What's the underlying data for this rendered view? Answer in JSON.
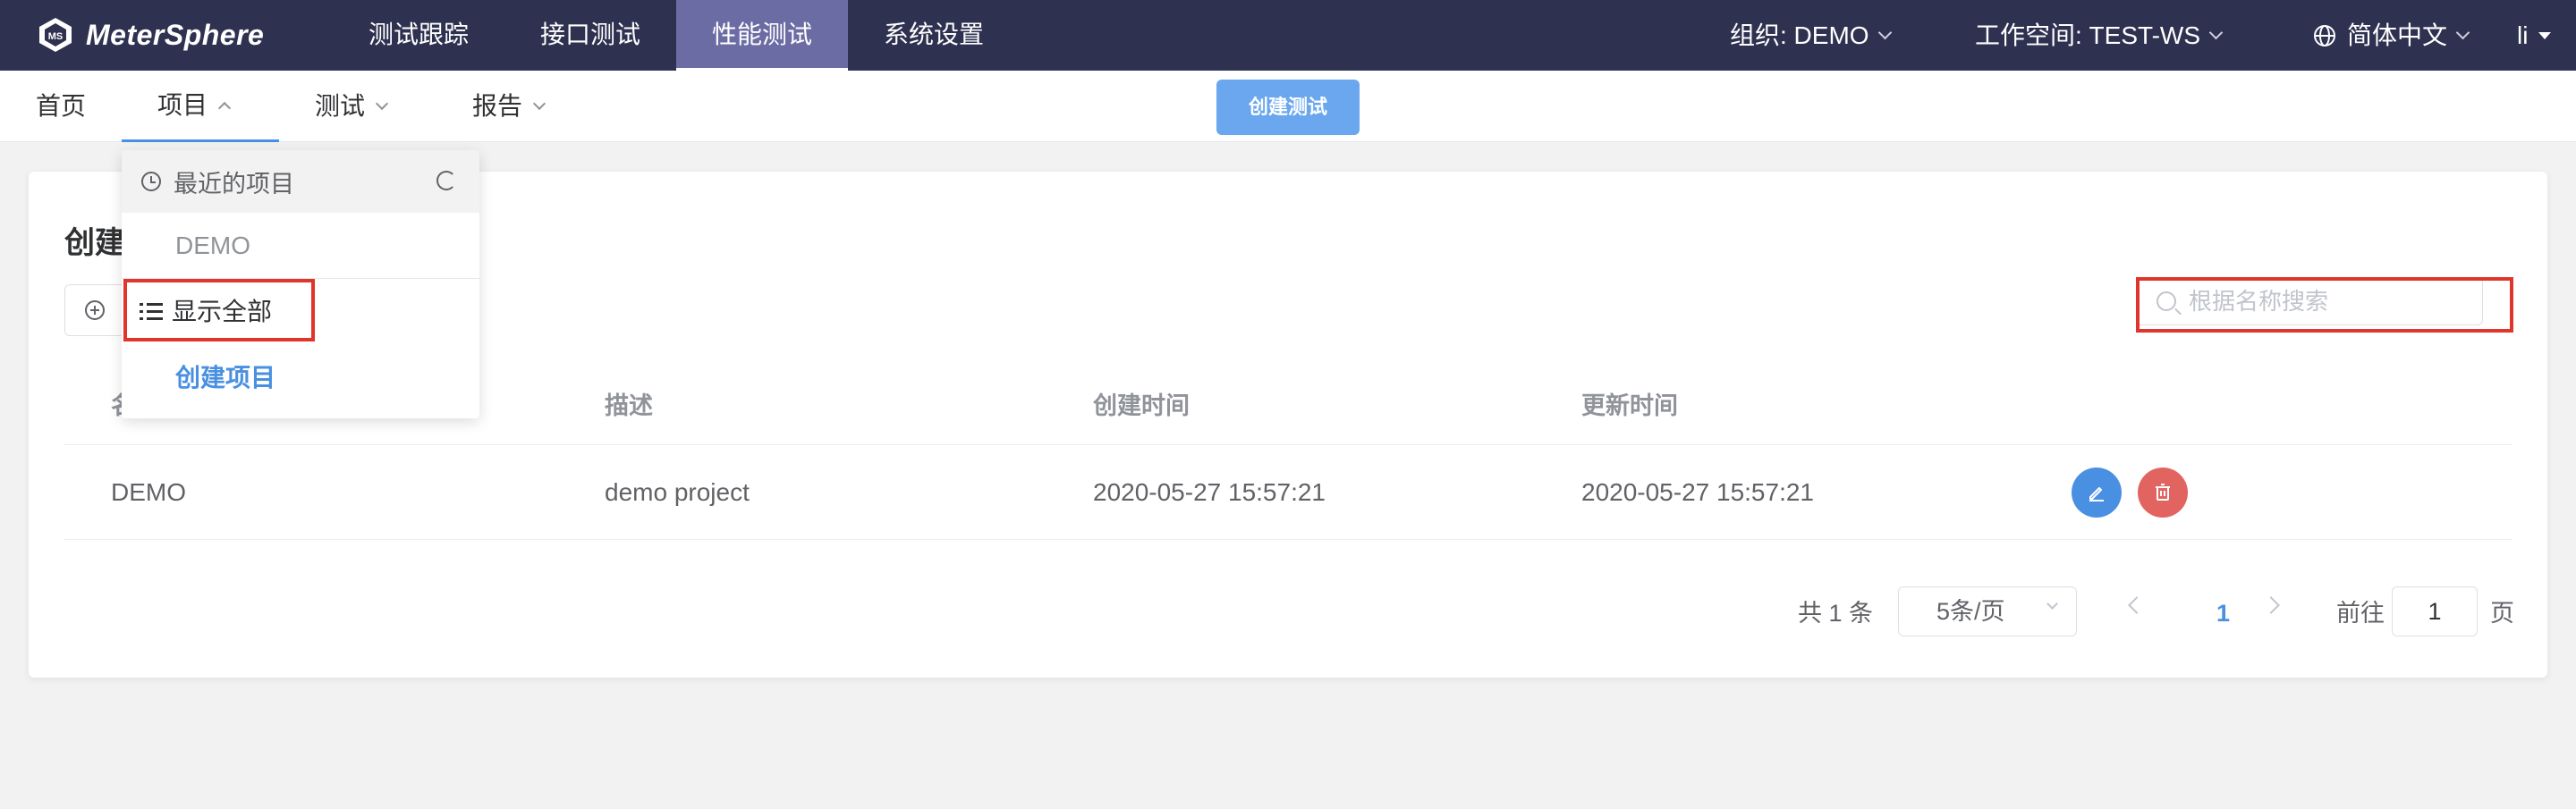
{
  "app": {
    "brand_name": "MeterSphere"
  },
  "main_nav": {
    "items": [
      {
        "label": "测试跟踪"
      },
      {
        "label": "接口测试"
      },
      {
        "label": "性能测试"
      },
      {
        "label": "系统设置"
      }
    ],
    "active": "性能测试"
  },
  "top_right": {
    "org": "组织: DEMO",
    "workspace": "工作空间: TEST-WS",
    "language": "简体中文",
    "user": "li"
  },
  "sub_nav": {
    "home": "首页",
    "project": "项目",
    "test": "测试",
    "report": "报告",
    "create_test_button": "创建测试"
  },
  "project_dropdown": {
    "recent_header": "最近的项目",
    "recent_items": [
      "DEMO"
    ],
    "show_all": "显示全部",
    "create_project": "创建项目"
  },
  "card": {
    "title": "创建",
    "search_placeholder": "根据名称搜索"
  },
  "table": {
    "columns": [
      "名称",
      "描述",
      "创建时间",
      "更新时间"
    ],
    "rows": [
      {
        "name": "DEMO",
        "description": "demo project",
        "created": "2020-05-27 15:57:21",
        "updated": "2020-05-27 15:57:21"
      }
    ]
  },
  "pagination": {
    "total": "共 1 条",
    "page_size": "5条/页",
    "current_page": "1",
    "goto_label": "前往",
    "goto_value": "1",
    "page_suffix": "页"
  },
  "colors": {
    "topbar": "#2f3150",
    "active_nav": "#6c6ca4",
    "primary": "#4a90e2",
    "create_button": "#6aa7ee",
    "danger": "#e26461",
    "highlight_box": "#e0352b"
  }
}
